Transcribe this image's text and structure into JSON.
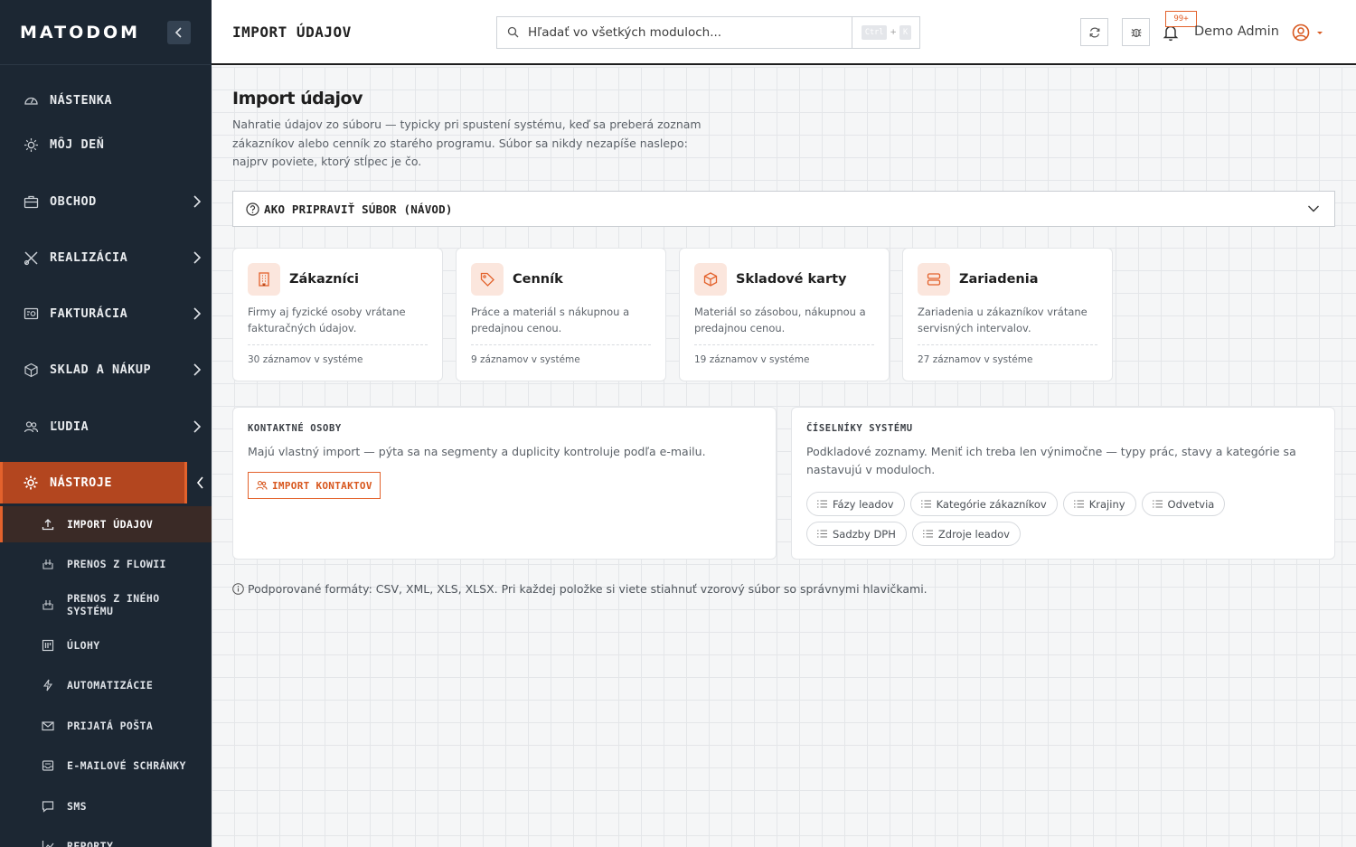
{
  "app": {
    "logo_part1": "MATO",
    "logo_part2": "DOM"
  },
  "sidebar": {
    "items": [
      {
        "label": "NÁSTENKA",
        "icon": "gauge-icon"
      },
      {
        "label": "MÔJ DEŇ",
        "icon": "sun-icon"
      },
      {
        "label": "OBCHOD",
        "icon": "briefcase-icon"
      },
      {
        "label": "REALIZÁCIA",
        "icon": "tools-icon"
      },
      {
        "label": "FAKTURÁCIA",
        "icon": "invoice-icon"
      },
      {
        "label": "SKLAD A NÁKUP",
        "icon": "box-icon"
      },
      {
        "label": "ĽUDIA",
        "icon": "users-icon"
      },
      {
        "label": "NÁSTROJE",
        "icon": "gear-icon"
      }
    ],
    "subitems": [
      {
        "label": "IMPORT ÚDAJOV",
        "icon": "upload-icon"
      },
      {
        "label": "PRENOS Z FLOWII",
        "icon": "transfer-icon"
      },
      {
        "label": "PRENOS Z INÉHO SYSTÉMU",
        "icon": "transfer-icon"
      },
      {
        "label": "ÚLOHY",
        "icon": "tasks-icon"
      },
      {
        "label": "AUTOMATIZÁCIE",
        "icon": "bolt-icon"
      },
      {
        "label": "PRIJATÁ POŠTA",
        "icon": "mail-icon"
      },
      {
        "label": "E-MAILOVÉ SCHRÁNKY",
        "icon": "inbox-icon"
      },
      {
        "label": "SMS",
        "icon": "message-icon"
      },
      {
        "label": "REPORTY",
        "icon": "chart-icon"
      }
    ]
  },
  "header": {
    "title": "IMPORT ÚDAJOV",
    "search_placeholder": "Hľadať vo všetkých moduloch...",
    "kbd1": "Ctrl",
    "kbd_plus": "+",
    "kbd2": "K",
    "notifications_badge": "99+",
    "user_name": "Demo Admin"
  },
  "main": {
    "heading": "Import údajov",
    "intro": "Nahratie údajov zo súboru — typicky pri spustení systému, keď sa preberá zoznam zákazníkov alebo cenník zo starého programu. Súbor sa nikdy nezapíše naslepo: najprv poviete, ktorý stĺpec je čo.",
    "guide_label": "AKO PRIPRAVIŤ SÚBOR (NÁVOD)",
    "cards": [
      {
        "title": "Zákazníci",
        "desc": "Firmy aj fyzické osoby vrátane fakturačných údajov.",
        "count": "30 záznamov v systéme",
        "icon": "building-icon"
      },
      {
        "title": "Cenník",
        "desc": "Práce a materiál s nákupnou a predajnou cenou.",
        "count": "9 záznamov v systéme",
        "icon": "tag-icon"
      },
      {
        "title": "Skladové karty",
        "desc": "Materiál so zásobou, nákupnou a predajnou cenou.",
        "count": "19 záznamov v systéme",
        "icon": "box-icon"
      },
      {
        "title": "Zariadenia",
        "desc": "Zariadenia u zákazníkov vrátane servisných intervalov.",
        "count": "27 záznamov v systéme",
        "icon": "server-icon"
      }
    ],
    "contacts": {
      "title": "KONTAKTNÉ OSOBY",
      "text": "Majú vlastný import — pýta sa na segmenty a duplicity kontroluje podľa e-mailu.",
      "button": "IMPORT KONTAKTOV"
    },
    "lists": {
      "title": "ČÍSELNÍKY SYSTÉMU",
      "text": "Podkladové zoznamy. Meniť ich treba len výnimočne — typy prác, stavy a kategórie sa nastavujú v moduloch.",
      "chips": [
        "Fázy leadov",
        "Kategórie zákazníkov",
        "Krajiny",
        "Odvetvia",
        "Sadzby DPH",
        "Zdroje leadov"
      ]
    },
    "footnote": "Podporované formáty: CSV, XML, XLS, XLSX. Pri každej položke si viete stiahnuť vzorový súbor so správnymi hlavičkami."
  },
  "colors": {
    "accent": "#e3622c",
    "sidebar_bg": "#1c2733",
    "active_bg": "#b3461f"
  }
}
